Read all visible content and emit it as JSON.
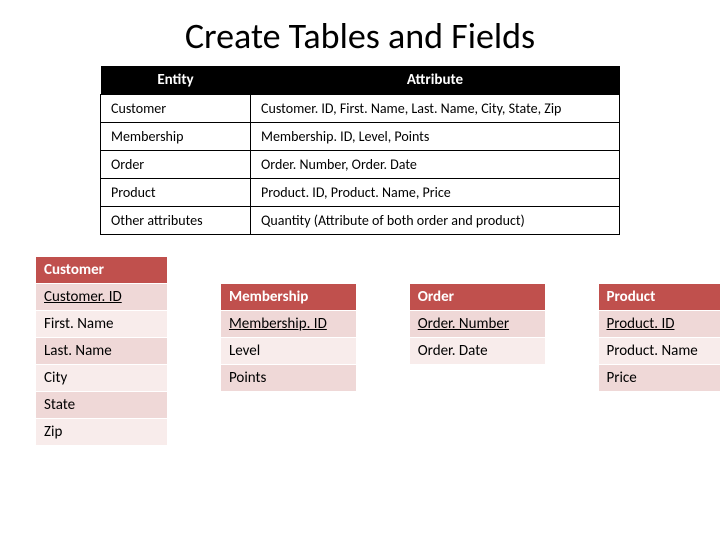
{
  "title": "Create Tables and Fields",
  "mainTable": {
    "headers": {
      "entity": "Entity",
      "attribute": "Attribute"
    },
    "rows": [
      {
        "entity": "Customer",
        "attribute": "Customer. ID, First. Name, Last. Name, City, State, Zip"
      },
      {
        "entity": "Membership",
        "attribute": "Membership. ID, Level, Points"
      },
      {
        "entity": "Order",
        "attribute": "Order. Number, Order. Date"
      },
      {
        "entity": "Product",
        "attribute": "Product. ID, Product. Name, Price"
      },
      {
        "entity": "Other attributes",
        "attribute": "Quantity (Attribute of both order and product)"
      }
    ]
  },
  "columns": [
    {
      "header": "Customer",
      "fields": [
        {
          "label": "Customer. ID",
          "pk": true
        },
        {
          "label": "First. Name",
          "pk": false
        },
        {
          "label": "Last. Name",
          "pk": false
        },
        {
          "label": "City",
          "pk": false
        },
        {
          "label": "State",
          "pk": false
        },
        {
          "label": "Zip",
          "pk": false
        }
      ]
    },
    {
      "header": "Membership",
      "fields": [
        {
          "label": "Membership. ID",
          "pk": true
        },
        {
          "label": "Level",
          "pk": false
        },
        {
          "label": "Points",
          "pk": false
        }
      ]
    },
    {
      "header": "Order",
      "fields": [
        {
          "label": "Order. Number",
          "pk": true
        },
        {
          "label": "Order. Date",
          "pk": false
        }
      ]
    },
    {
      "header": "Product",
      "fields": [
        {
          "label": "Product. ID",
          "pk": true
        },
        {
          "label": "Product. Name",
          "pk": false
        },
        {
          "label": "Price",
          "pk": false
        }
      ]
    }
  ]
}
